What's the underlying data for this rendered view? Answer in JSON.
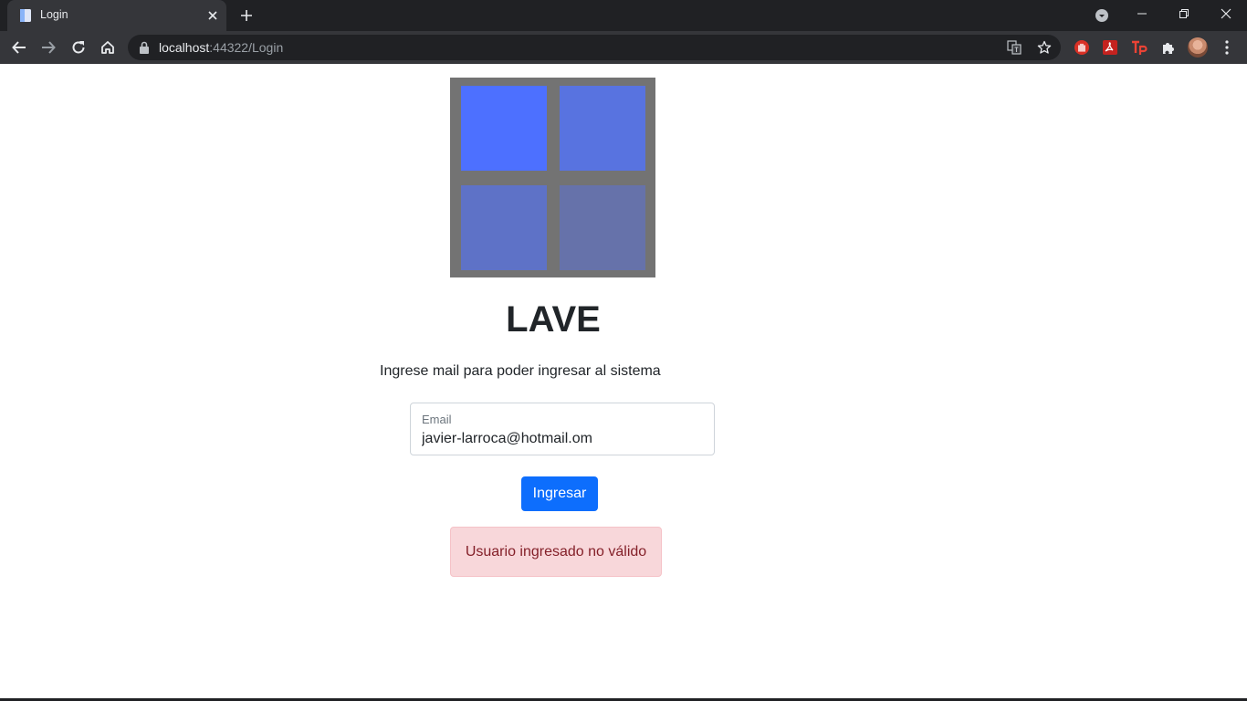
{
  "browser": {
    "tab": {
      "title": "Login"
    },
    "url": {
      "host": "localhost",
      "rest": ":44322/Login"
    }
  },
  "page": {
    "heading": "LAVE",
    "subtitle": "Ingrese mail para poder ingresar al sistema",
    "email_field": {
      "label": "Email",
      "value": "javier-larroca@hotmail.om"
    },
    "submit_label": "Ingresar",
    "alert_text": "Usuario ingresado no válido"
  },
  "colors": {
    "primary": "#0d6efd",
    "alert_bg": "#f8d7da",
    "alert_text": "#842029",
    "logo_frame": "#737373",
    "logo_tiles": [
      "#4d70ff",
      "#5873e0",
      "#5e72c7",
      "#6672aa"
    ]
  },
  "icons": {
    "tab": [
      "page-icon",
      "close-icon",
      "plus-icon",
      "tab-search-icon"
    ],
    "window": [
      "minimize-icon",
      "restore-icon",
      "close-icon"
    ],
    "toolbar": [
      "back-arrow-icon",
      "forward-arrow-icon",
      "reload-icon",
      "home-icon",
      "lock-icon",
      "translate-icon",
      "star-icon",
      "adblock-icon",
      "pdf-icon",
      "tp-extension-icon",
      "puzzle-icon",
      "profile-avatar",
      "kebab-menu-icon"
    ]
  }
}
